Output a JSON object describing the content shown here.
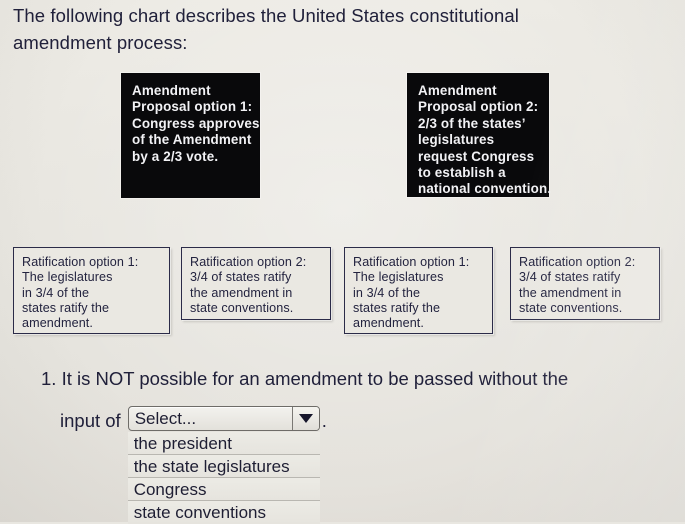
{
  "intro": {
    "line1": "The following chart describes the United States constitutional",
    "line2": "amendment process:"
  },
  "diagram": {
    "proposal_boxes": [
      {
        "name": "amendment-proposal-option-1",
        "lines": [
          "Amendment",
          "Proposal option 1:",
          "Congress approves",
          "of the Amendment",
          "by a 2/3 vote."
        ]
      },
      {
        "name": "amendment-proposal-option-2",
        "lines": [
          "Amendment",
          "Proposal option 2:",
          "2/3 of the states’",
          "legislatures",
          "request Congress",
          "to establish a",
          "national convention."
        ]
      }
    ],
    "ratification_boxes": [
      {
        "name": "ratification-option-1-left",
        "lines": [
          "Ratification option 1:",
          "The legislatures",
          "in 3/4 of the",
          "states ratify the",
          "amendment."
        ]
      },
      {
        "name": "ratification-option-2-left",
        "lines": [
          "Ratification option 2:",
          "3/4 of states ratify",
          "the amendment in",
          "state conventions."
        ]
      },
      {
        "name": "ratification-option-1-right",
        "lines": [
          "Ratification option 1:",
          "The legislatures",
          "in 3/4 of the",
          "states ratify the",
          "amendment."
        ]
      },
      {
        "name": "ratification-option-2-right",
        "lines": [
          "Ratification option 2:",
          "3/4 of states ratify",
          "the amendment in",
          "state conventions."
        ]
      }
    ]
  },
  "question": {
    "number": "1.",
    "text": "It is NOT possible for an amendment to be passed without the",
    "answer_prefix": "input of",
    "trailing_punctuation": "."
  },
  "select": {
    "value": "Select...",
    "arrow_icon": "chevron-down-icon",
    "options": [
      "the president",
      "the state legislatures",
      "Congress",
      "state conventions"
    ]
  },
  "colors": {
    "page_background": "#e9e7e1",
    "box_fill": "#09090b",
    "box_text": "#f2f2f5",
    "body_text": "#20203a",
    "rat_border": "#2b2b48"
  }
}
